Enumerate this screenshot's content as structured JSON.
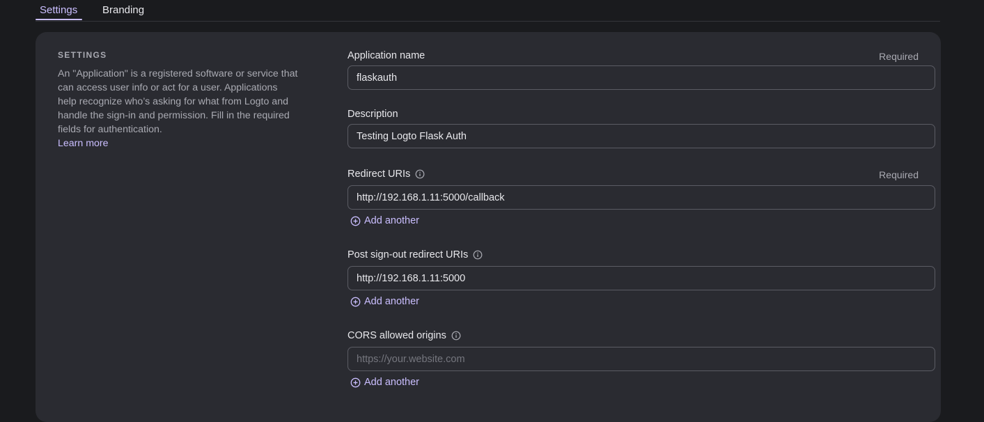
{
  "tabs": [
    {
      "label": "Settings",
      "active": true
    },
    {
      "label": "Branding",
      "active": false
    }
  ],
  "section": {
    "title": "SETTINGS",
    "description": "An \"Application\" is a registered software or service that can access user info or act for a user. Applications help recognize who’s asking for what from Logto and handle the sign-in and permission. Fill in the required fields for authentication.",
    "learn_more": "Learn more"
  },
  "fields": {
    "app_name": {
      "label": "Application name",
      "required": "Required",
      "value": "flaskauth"
    },
    "description": {
      "label": "Description",
      "value": "Testing Logto Flask Auth"
    },
    "redirect_uris": {
      "label": "Redirect URIs",
      "required": "Required",
      "value": "http://192.168.1.11:5000/callback",
      "add_label": "Add another"
    },
    "post_signout": {
      "label": "Post sign-out redirect URIs",
      "value": "http://192.168.1.11:5000",
      "add_label": "Add another"
    },
    "cors": {
      "label": "CORS allowed origins",
      "value": "",
      "placeholder": "https://your.website.com",
      "add_label": "Add another"
    }
  },
  "colors": {
    "accent": "#cabeff",
    "background": "#1a1b1e",
    "card": "#2a2b31",
    "border": "#5b5c64"
  },
  "icons": {
    "info": "info-circle-icon",
    "add": "plus-circle-icon"
  }
}
